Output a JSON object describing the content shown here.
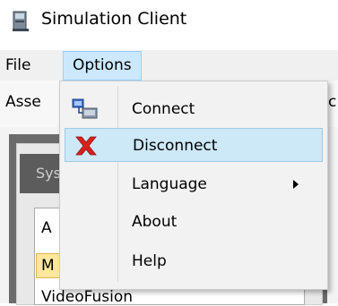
{
  "window": {
    "title": "Simulation Client"
  },
  "menubar": {
    "items": [
      {
        "label": "File"
      },
      {
        "label": "Options"
      }
    ]
  },
  "background": {
    "tab_label_partial": "Asse",
    "right_partial": "c",
    "panel_tab_partial": "Sys",
    "list_items_partial": [
      "A",
      "M",
      "VideoFusion"
    ]
  },
  "options_menu": {
    "items": [
      {
        "label": "Connect",
        "icon": "connect-icon"
      },
      {
        "label": "Disconnect",
        "icon": "disconnect-icon",
        "highlighted": true
      },
      {
        "label": "Language",
        "has_submenu": true
      },
      {
        "label": "About"
      },
      {
        "label": "Help"
      }
    ]
  },
  "colors": {
    "menu_highlight": "#cde8f7",
    "menu_highlight_border": "#9fcbe6",
    "options_active": "#cce8ff",
    "disconnect_red": "#d9211f",
    "selected_list_item": "#fde79c"
  }
}
